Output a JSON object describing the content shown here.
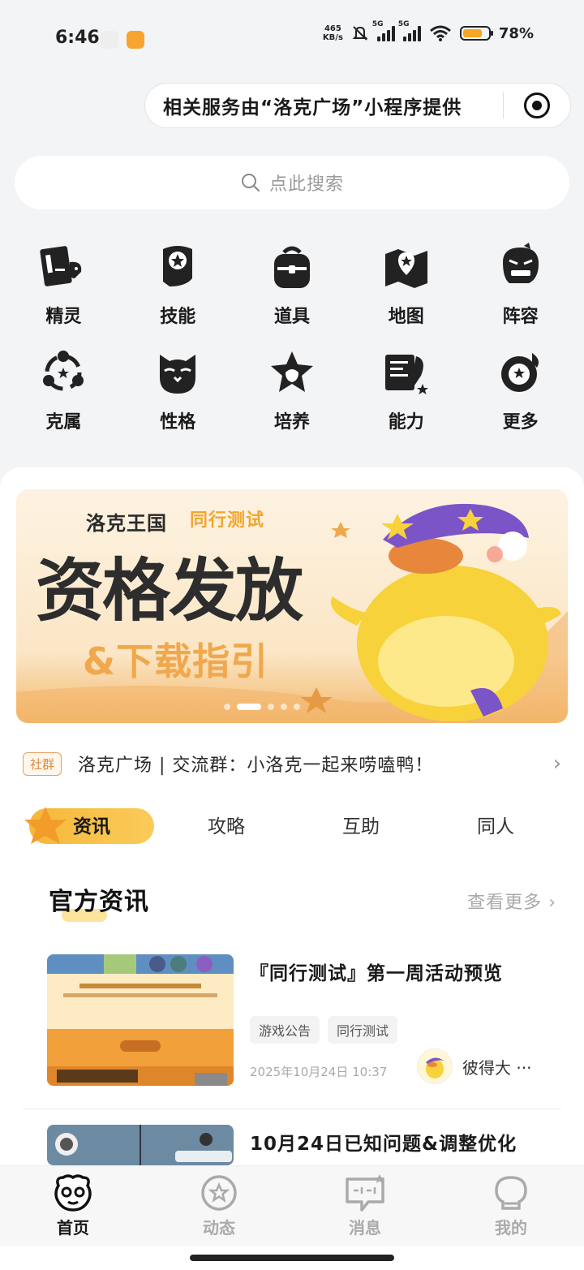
{
  "status_bar": {
    "time": "6:46",
    "net_speed_value": "465",
    "net_speed_unit": "KB/s",
    "signal_1": "5G",
    "signal_2": "5G",
    "battery_level": 0.78,
    "battery_text": "78%"
  },
  "capsule": {
    "provider_text": "相关服务由“洛克广场”小程序提供"
  },
  "search": {
    "placeholder": "点此搜索"
  },
  "categories": [
    {
      "label": "精灵",
      "icon": "sprite-book-icon"
    },
    {
      "label": "技能",
      "icon": "skill-scroll-icon"
    },
    {
      "label": "道具",
      "icon": "backpack-icon"
    },
    {
      "label": "地图",
      "icon": "map-icon"
    },
    {
      "label": "阵容",
      "icon": "lineup-icon"
    },
    {
      "label": "克属",
      "icon": "type-cycle-icon"
    },
    {
      "label": "性格",
      "icon": "owl-icon"
    },
    {
      "label": "培养",
      "icon": "cat-star-icon"
    },
    {
      "label": "能力",
      "icon": "ability-icon"
    },
    {
      "label": "更多",
      "icon": "more-icon"
    }
  ],
  "banner": {
    "brand": "洛克王国",
    "tag": "同行测试",
    "title": "资格发放",
    "subtitle": "&下载指引"
  },
  "notice": {
    "badge": "社群",
    "text": "洛克广场 | 交流群：小洛克一起来唠嗑鸭！"
  },
  "tabs": [
    {
      "label": "资讯",
      "active": true
    },
    {
      "label": "攻略",
      "active": false
    },
    {
      "label": "互助",
      "active": false
    },
    {
      "label": "同人",
      "active": false
    }
  ],
  "section": {
    "title": "官方资讯",
    "more": "查看更多"
  },
  "articles": [
    {
      "title": "『同行测试』第一周活动预览",
      "tags": [
        "游戏公告",
        "同行测试"
      ],
      "date": "2025年10月24日",
      "time": "10:37",
      "author": "彼得大 ···"
    },
    {
      "title": "10月24日已知问题&调整优化"
    }
  ],
  "bottom_nav": [
    {
      "label": "首页",
      "active": true
    },
    {
      "label": "动态",
      "active": false
    },
    {
      "label": "消息",
      "active": false
    },
    {
      "label": "我的",
      "active": false
    }
  ],
  "colors": {
    "accent": "#f6b73a",
    "background": "#f3f4f6",
    "notice_badge": "#e08a3c"
  }
}
